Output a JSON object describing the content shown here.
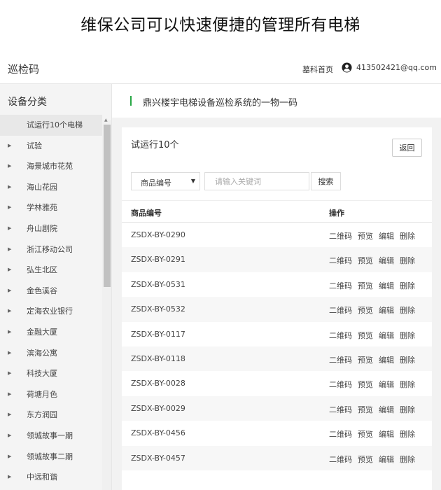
{
  "banner": {
    "text": "维保公司可以快速便捷的管理所有电梯"
  },
  "header": {
    "title": "巡检码",
    "home_link": "墓科首页",
    "user_email": "413502421@qq.com"
  },
  "sidebar": {
    "title": "设备分类",
    "items": [
      {
        "label": "试运行10个电梯",
        "active": true
      },
      {
        "label": "试验"
      },
      {
        "label": "海景城市花苑"
      },
      {
        "label": "海山花园"
      },
      {
        "label": "学林雅苑"
      },
      {
        "label": "舟山剧院"
      },
      {
        "label": "浙江移动公司"
      },
      {
        "label": "弘生北区"
      },
      {
        "label": "金色溪谷"
      },
      {
        "label": "定海农业银行"
      },
      {
        "label": "金融大厦"
      },
      {
        "label": "滨海公寓"
      },
      {
        "label": "科技大厦"
      },
      {
        "label": "荷塘月色"
      },
      {
        "label": "东方润园"
      },
      {
        "label": "领城故事一期"
      },
      {
        "label": "领城故事二期"
      },
      {
        "label": "中远和谐"
      }
    ]
  },
  "main": {
    "notice": "鼎兴楼宇电梯设备巡检系统的一物一码",
    "card_title": "试运行10个",
    "back_button": "返回",
    "search": {
      "select_value": "商品编号",
      "placeholder": "请输入关键词",
      "button": "搜索"
    },
    "table": {
      "columns": [
        "商品编号",
        "操作"
      ],
      "actions": [
        "二维码",
        "预览",
        "编辑",
        "删除"
      ],
      "rows": [
        {
          "code": "ZSDX-BY-0290"
        },
        {
          "code": "ZSDX-BY-0291"
        },
        {
          "code": "ZSDX-BY-0531"
        },
        {
          "code": "ZSDX-BY-0532"
        },
        {
          "code": "ZSDX-BY-0117"
        },
        {
          "code": "ZSDX-BY-0118"
        },
        {
          "code": "ZSDX-BY-0028"
        },
        {
          "code": "ZSDX-BY-0029"
        },
        {
          "code": "ZSDX-BY-0456"
        },
        {
          "code": "ZSDX-BY-0457"
        }
      ]
    }
  },
  "colors": {
    "accent": "#28a745",
    "sidebar_bg": "#f4f4f4",
    "main_bg": "#f2f2f2"
  },
  "icons": {
    "user": "user-circle-icon",
    "caret": "caret-down-icon",
    "tree_arrow": "chevron-right-icon"
  }
}
